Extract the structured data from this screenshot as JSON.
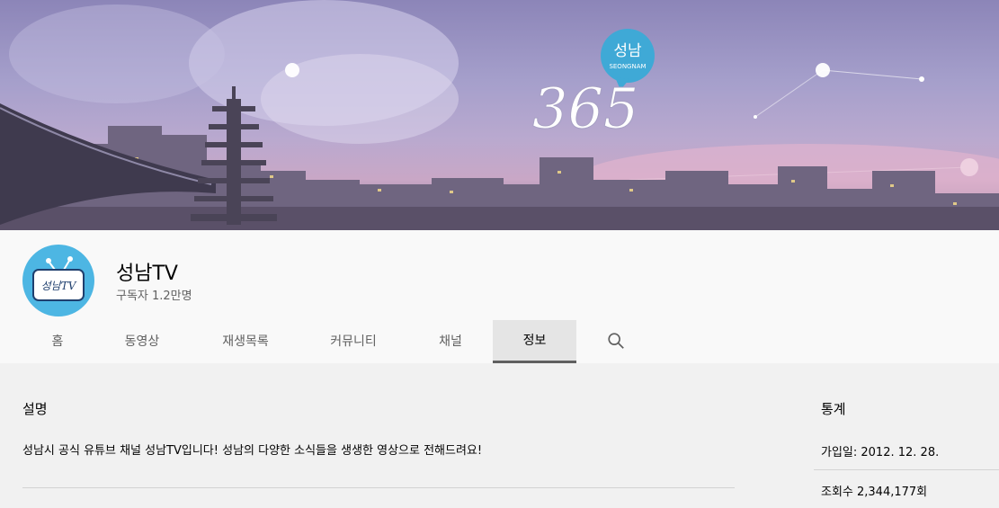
{
  "banner": {
    "logo_city": "성남",
    "logo_sub": "SEONGNAM",
    "logo_number": "365"
  },
  "channel": {
    "name": "성남TV",
    "subscribers": "구독자 1.2만명",
    "avatar_text": "성남TV"
  },
  "tabs": [
    {
      "label": "홈"
    },
    {
      "label": "동영상"
    },
    {
      "label": "재생목록"
    },
    {
      "label": "커뮤니티"
    },
    {
      "label": "채널"
    },
    {
      "label": "정보",
      "active": true
    }
  ],
  "description": {
    "title": "설명",
    "text": "성남시 공식 유튜브 채널 성남TV입니다! 성남의 다양한 소식들을 생생한 영상으로 전해드려요!"
  },
  "stats": {
    "title": "통계",
    "joined": "가입일: 2012. 12. 28.",
    "views": "조회수 2,344,177회"
  },
  "colors": {
    "accent": "#606060",
    "avatar_bg": "#4db6e3",
    "logo_bubble": "#3fa9d6"
  }
}
